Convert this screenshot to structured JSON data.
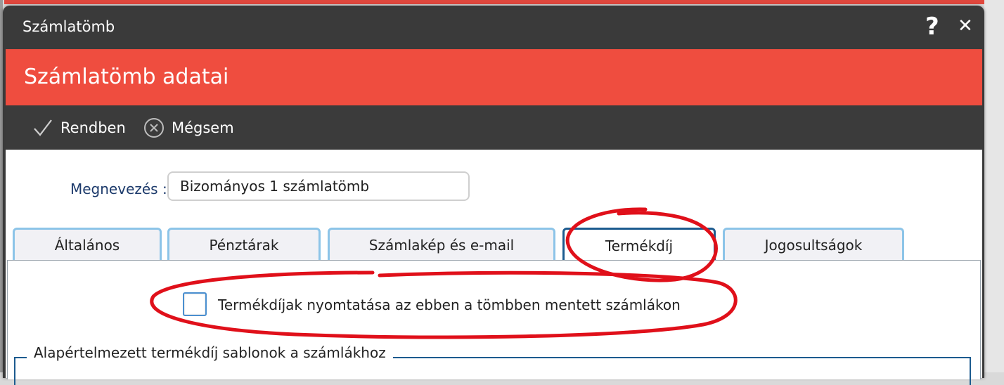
{
  "window": {
    "title": "Számlatömb",
    "help_label": "?",
    "close_label": "✕"
  },
  "header": {
    "title": "Számlatömb adatai"
  },
  "toolbar": {
    "ok_label": "Rendben",
    "cancel_label": "Mégsem"
  },
  "form": {
    "name_label": "Megnevezés :",
    "name_value": "Bizományos 1 számlatömb"
  },
  "tabs": [
    {
      "label": "Általános"
    },
    {
      "label": "Pénztárak"
    },
    {
      "label": "Számlakép és e-mail"
    },
    {
      "label": "Termékdíj",
      "active": true
    },
    {
      "label": "Jogosultságok"
    }
  ],
  "panel": {
    "checkbox_label": "Termékdíjak nyomtatása az ebben a tömbben mentett számlákon",
    "checkbox_checked": false,
    "group_legend": "Alapértelmezett termékdíj sablonok a számlákhoz"
  },
  "colors": {
    "header_red": "#ef4d3f",
    "toolbar_dark": "#3b3b3b",
    "tab_border": "#8cc4e8",
    "tab_active_border": "#1c5b8f",
    "annotation_red": "#e0101a"
  },
  "icons": {
    "ok": "checkmark-icon",
    "cancel": "circle-x-icon"
  }
}
